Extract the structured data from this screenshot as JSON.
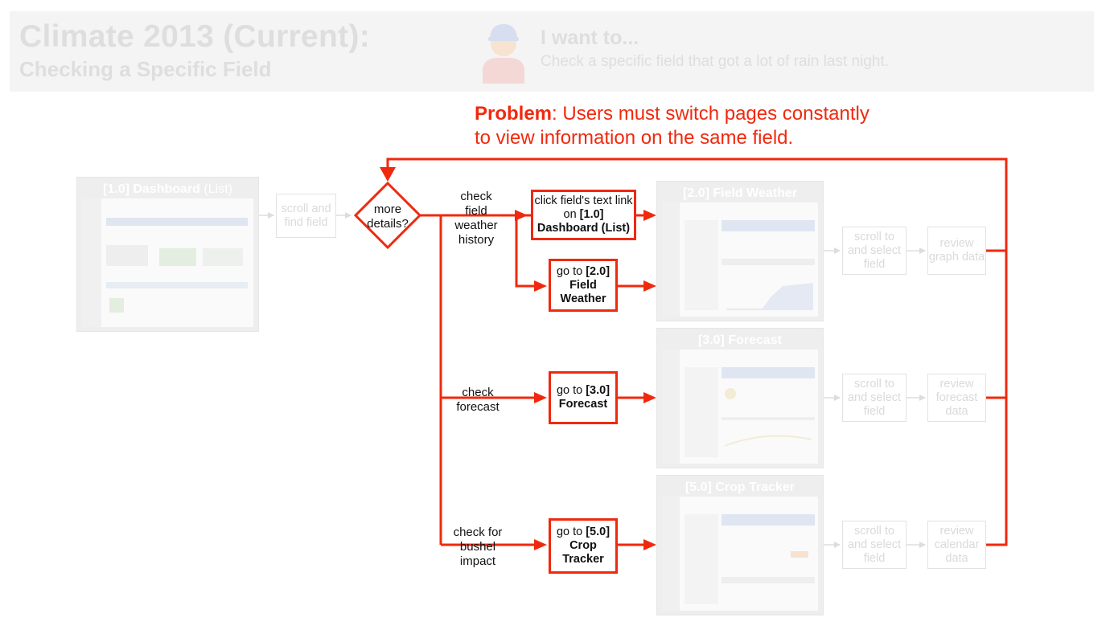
{
  "header": {
    "title": "Climate 2013 (Current):",
    "subtitle": "Checking a Specific Field",
    "want_title": "I want to...",
    "want_desc": "Check a specific field that got a lot of rain last night."
  },
  "problem": {
    "label": "Problem",
    "text_line1": ": Users must switch pages constantly",
    "text_line2": "to view information on the same field."
  },
  "screens": {
    "dashboard": {
      "num": "[1.0]",
      "name": "Dashboard",
      "suffix": "(List)"
    },
    "field_weather": {
      "title": "[2.0] Field Weather"
    },
    "forecast": {
      "title": "[3.0] Forecast"
    },
    "crop_tracker": {
      "title": "[5.0] Crop Tracker"
    }
  },
  "steps": {
    "scroll_find": "scroll and find field",
    "decision": "more details?",
    "branch1_label": "check field weather history",
    "branch2_label": "check forecast",
    "branch3_label": "check for bushel impact",
    "box_click_pre": "click field's text link on ",
    "box_click_ref": "[1.0] Dashboard (List)",
    "box_fw_pre": "go to ",
    "box_fw_ref": "[2.0] Field Weather",
    "box_fc_pre": "go to ",
    "box_fc_ref": "[3.0] Forecast",
    "box_ct_pre": "go to ",
    "box_ct_ref": "[5.0] Crop Tracker",
    "scroll_select_1": "scroll to and select field",
    "scroll_select_2": "scroll to and select field",
    "scroll_select_3": "scroll to and select field",
    "review_graph": "review graph data",
    "review_forecast": "review forecast data",
    "review_calendar": "review calendar data"
  },
  "colors": {
    "accent": "#f0290e",
    "faded": "#dadada"
  }
}
